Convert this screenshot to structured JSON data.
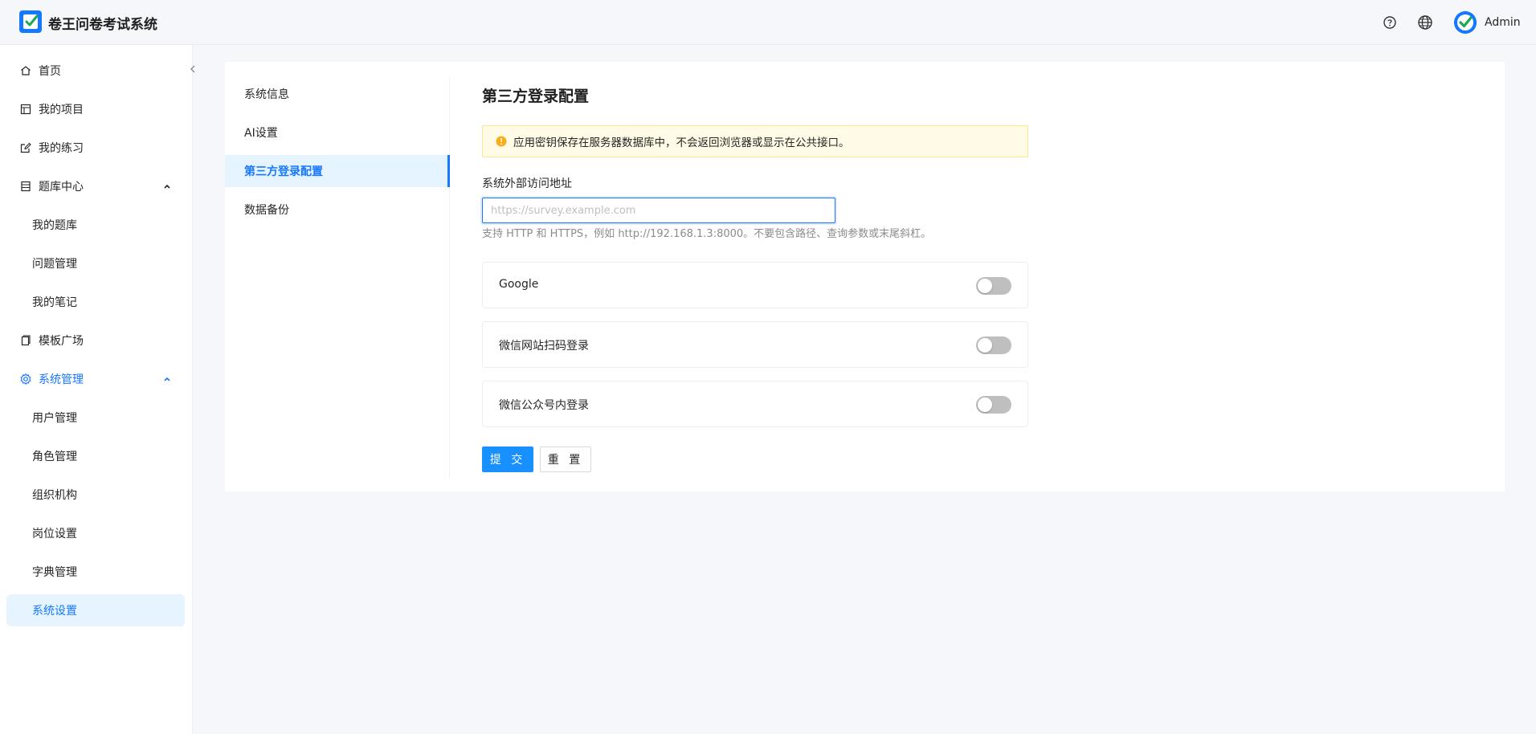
{
  "app": {
    "title": "卷王问卷考试系统"
  },
  "header": {
    "icons": [
      "help-icon",
      "globe-icon"
    ],
    "user": {
      "name": "Admin",
      "avatar_icon": "checkmark-avatar-icon"
    }
  },
  "sidebar": {
    "items": [
      {
        "label": "首页",
        "icon": "home-icon"
      },
      {
        "label": "我的项目",
        "icon": "project-icon"
      },
      {
        "label": "我的练习",
        "icon": "edit-icon"
      },
      {
        "label": "题库中心",
        "icon": "database-icon",
        "expanded": true,
        "children": [
          {
            "label": "我的题库"
          },
          {
            "label": "问题管理"
          },
          {
            "label": "我的笔记"
          }
        ]
      },
      {
        "label": "模板广场",
        "icon": "template-icon"
      },
      {
        "label": "系统管理",
        "icon": "gear-icon",
        "expanded": true,
        "active": true,
        "children": [
          {
            "label": "用户管理"
          },
          {
            "label": "角色管理"
          },
          {
            "label": "组织机构"
          },
          {
            "label": "岗位设置"
          },
          {
            "label": "字典管理"
          },
          {
            "label": "系统设置",
            "selected": true
          }
        ]
      }
    ]
  },
  "settings_nav": {
    "items": [
      {
        "label": "系统信息"
      },
      {
        "label": "AI设置"
      },
      {
        "label": "第三方登录配置",
        "selected": true
      },
      {
        "label": "数据备份"
      }
    ]
  },
  "panel": {
    "title": "第三方登录配置",
    "alert": "应用密钥保存在服务器数据库中，不会返回浏览器或显示在公共接口。",
    "url_field": {
      "label": "系统外部访问地址",
      "value": "",
      "placeholder": "https://survey.example.com",
      "help": "支持 HTTP 和 HTTPS，例如 http://192.168.1.3:8000。不要包含路径、查询参数或末尾斜杠。"
    },
    "providers": [
      {
        "name": "Google",
        "enabled": false
      },
      {
        "name": "微信网站扫码登录",
        "enabled": false
      },
      {
        "name": "微信公众号内登录",
        "enabled": false
      }
    ],
    "buttons": {
      "submit": "提 交",
      "reset": "重 置"
    }
  },
  "colors": {
    "primary": "#1677ff",
    "alert_bg": "#fffbe6",
    "alert_border": "#ffe58f",
    "selected_bg": "#e6f4ff"
  }
}
